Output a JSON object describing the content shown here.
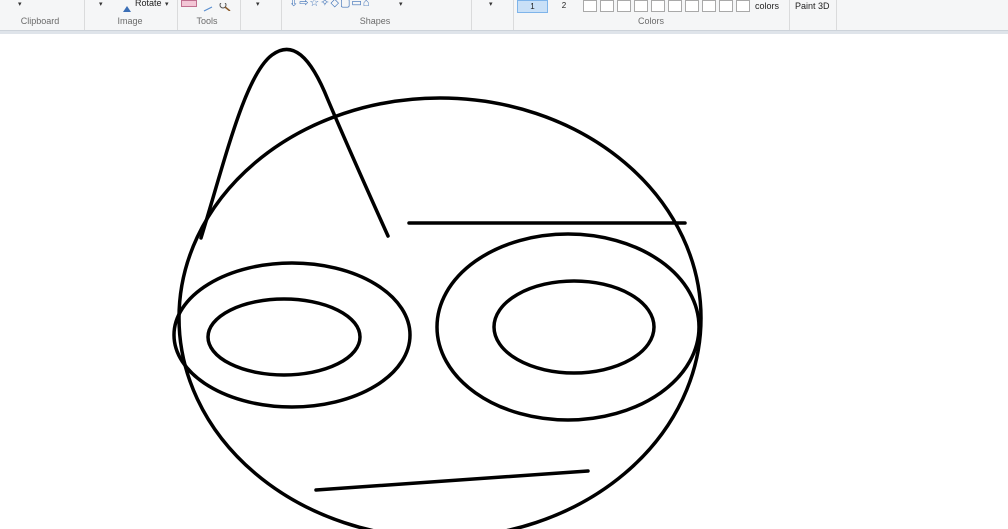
{
  "ribbon": {
    "groups": {
      "clipboard": "Clipboard",
      "image": "Image",
      "tools": "Tools",
      "shapes": "Shapes",
      "colors": "Colors"
    },
    "rotate_label": "Rotate",
    "color1_label": "1",
    "color2_label": "2",
    "edit_colors_label": "colors",
    "paint3d_label": "Paint 3D"
  },
  "colors": {
    "stroke": "#000000",
    "canvas": "#ffffff",
    "active_color_bg": "#c9e0f7"
  },
  "icons": [
    "dropdown-icon",
    "rotate-icon",
    "pencil-icon",
    "magnifier-icon",
    "shape-gallery-icons"
  ],
  "canvas": {
    "drawing": "face sketch"
  }
}
